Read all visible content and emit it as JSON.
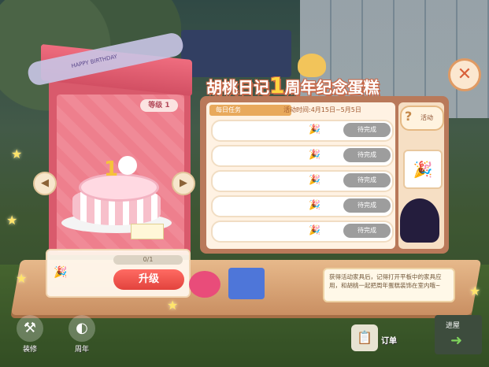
{
  "title": {
    "before": "胡桃日记",
    "number": "1",
    "after": "周年纪念蛋糕"
  },
  "gift_box": {
    "ribbon_text": "HAPPY BIRTHDAY",
    "level_badge": "等级 1"
  },
  "upgrade": {
    "progress_text": "0/1",
    "progress_fraction": 0,
    "button_label": "升级"
  },
  "board": {
    "tab_daily": "每日任务",
    "activity_time": "活动时间:4月15日~5月5日",
    "tasks": [
      {
        "status": "待完成"
      },
      {
        "status": "待完成"
      },
      {
        "status": "待完成"
      },
      {
        "status": "待完成"
      },
      {
        "status": "待完成"
      }
    ]
  },
  "side": {
    "help_label": "活动"
  },
  "bubble": {
    "text": "获得活动家具后，记得打开平板中的家具应用，和胡桃一起把周年蛋糕装饰在室内哦~"
  },
  "bottom": {
    "dress_label": "装修",
    "anniv_label": "周年",
    "order_label": "订单",
    "enter_label": "进屋"
  },
  "icons": {
    "close": "close-icon",
    "arrow_left": "chevron-left-icon",
    "arrow_right": "chevron-right-icon",
    "party": "party-popper-icon",
    "help": "question-mark-icon"
  },
  "colors": {
    "accent": "#e2433d",
    "board": "#b9795a",
    "pending": "#9d9d9d"
  }
}
